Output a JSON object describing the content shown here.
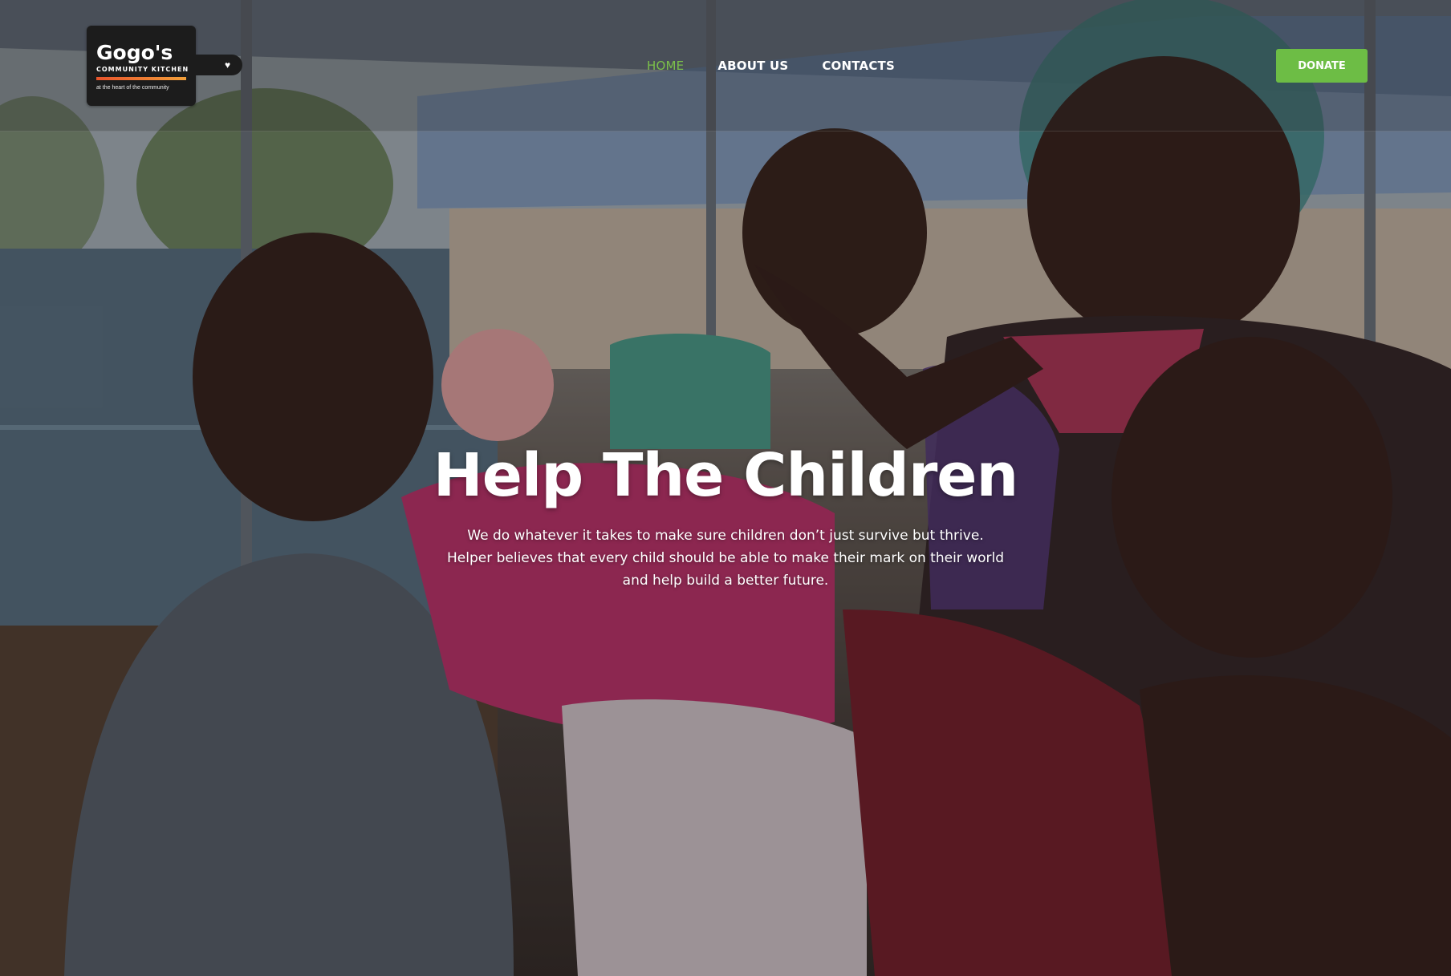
{
  "logo": {
    "name": "Gogo's",
    "subtitle": "COMMUNITY KITCHEN",
    "tagline": "at the heart of the community",
    "heart_icon": "heart-icon"
  },
  "nav": {
    "items": [
      {
        "label": "HOME",
        "active": true
      },
      {
        "label": "ABOUT US",
        "active": false
      },
      {
        "label": "CONTACTS",
        "active": false
      }
    ]
  },
  "donate_label": "DONATE",
  "hero": {
    "title": "Help The Children",
    "text": "We do whatever it takes to make sure children don’t just survive but thrive. Helper believes that every child should be able to make their mark on their world and help build a better future."
  },
  "colors": {
    "accent": "#6dbd45",
    "active_nav": "#7cc04a",
    "logo_bg": "#1c1c1c"
  }
}
